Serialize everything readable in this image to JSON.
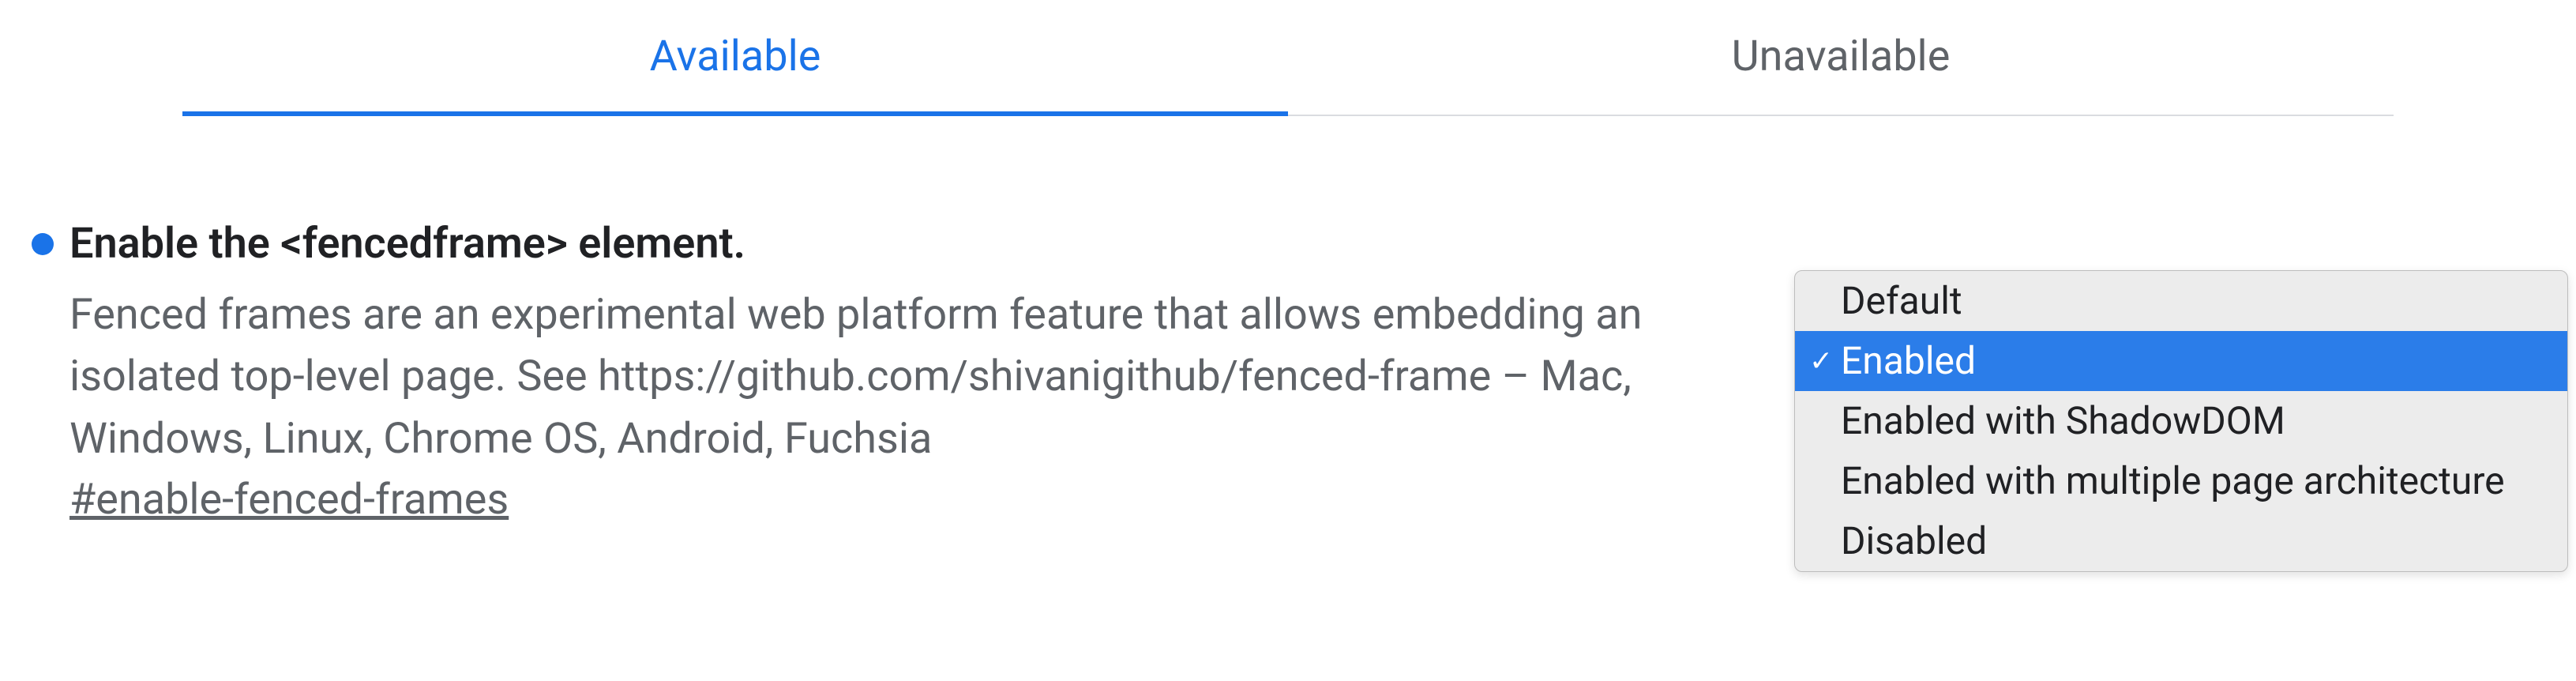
{
  "tabs": {
    "available": "Available",
    "unavailable": "Unavailable"
  },
  "flag": {
    "title": "Enable the <fencedframe> element.",
    "description": "Fenced frames are an experimental web platform feature that allows embedding an isolated top-level page. See https://github.com/shivanigithub/fenced-frame – Mac, Windows, Linux, Chrome OS, Android, Fuchsia",
    "hash": "#enable-fenced-frames",
    "modified_indicator_color": "#1a73e8"
  },
  "dropdown": {
    "options": [
      "Default",
      "Enabled",
      "Enabled with ShadowDOM",
      "Enabled with multiple page architecture",
      "Disabled"
    ],
    "selected_index": 1
  }
}
